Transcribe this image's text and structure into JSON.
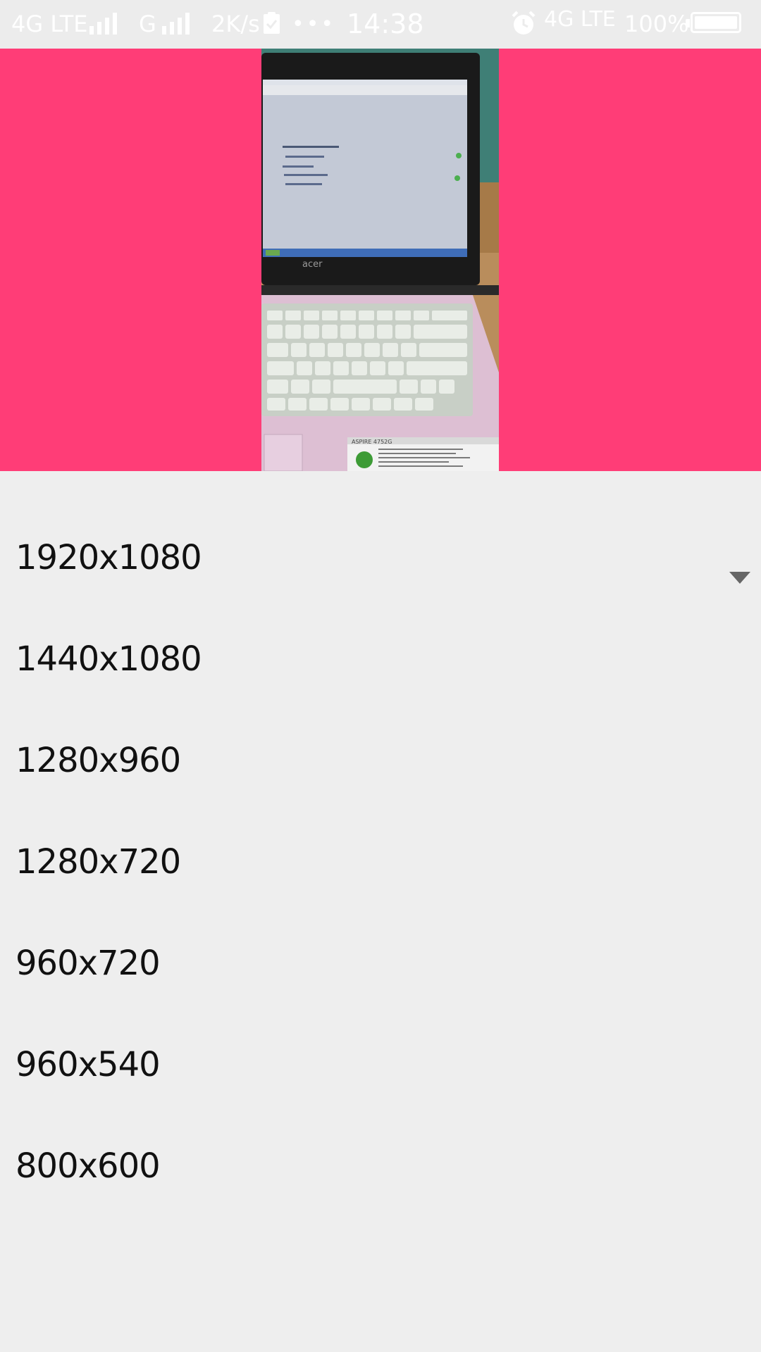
{
  "status_bar": {
    "network_left": "4G LTE",
    "network_second": "G",
    "speed": "2K/s",
    "dots": "•••",
    "time": "14:38",
    "network_right": "4G LTE",
    "battery": "100%"
  },
  "preview": {
    "background_color": "#ff3d77",
    "photo_brand": "acer",
    "photo_model": "ASPIRE 4752G"
  },
  "resolutions": {
    "items": [
      {
        "label": "1920x1080"
      },
      {
        "label": "1440x1080"
      },
      {
        "label": "1280x960"
      },
      {
        "label": "1280x720"
      },
      {
        "label": "960x720"
      },
      {
        "label": "960x540"
      },
      {
        "label": "800x600"
      }
    ],
    "dropdown_icon": "triangle-down-icon"
  }
}
